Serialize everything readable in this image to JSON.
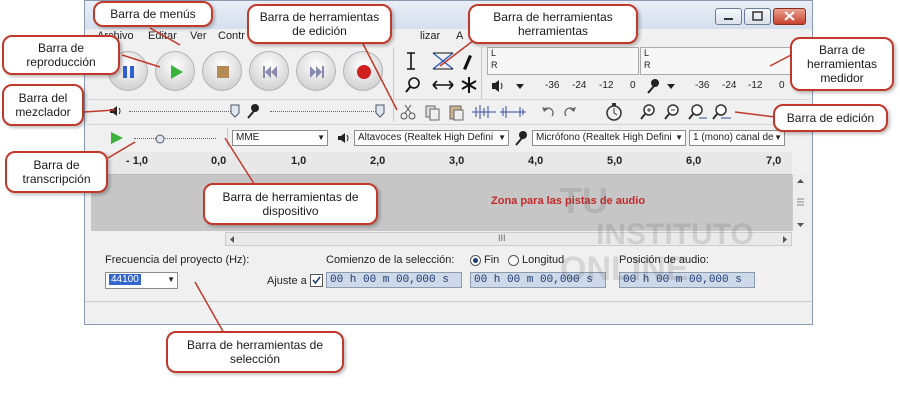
{
  "window": {
    "menus": [
      "Archivo",
      "Editar",
      "Ver",
      "Contr",
      "lizar",
      "A"
    ]
  },
  "meter": {
    "left_label": "L",
    "right_label": "R",
    "ticks": [
      "-36",
      "-24",
      "-12",
      "0"
    ]
  },
  "devices": {
    "host": "MME",
    "output": "Altavoces (Realtek High Defini",
    "input": "Micrófono (Realtek High Defini",
    "channels": "1 (mono) canal de"
  },
  "ruler": {
    "ticks": [
      "- 1,0",
      "0,0",
      "1,0",
      "2,0",
      "3,0",
      "4,0",
      "5,0",
      "6,0",
      "7,0"
    ]
  },
  "tracks_area": {
    "label": "Zona para las pistas de audio"
  },
  "scrollbar": {
    "grip": "III"
  },
  "selection": {
    "rate_label": "Frecuencia del proyecto (Hz):",
    "rate_value": "44100",
    "snap_label": "Ajuste a",
    "start_label": "Comienzo de la selección:",
    "end_option": "Fin",
    "length_option": "Longitud",
    "position_label": "Posición de audio:",
    "time_value": "00 h 00 m 00,000 s"
  },
  "callouts": {
    "menus": "Barra de menús",
    "playback": "Barra de reproducción",
    "mixer": "Barra del mezclador",
    "transcription": "Barra de transcripción",
    "edit_tools": "Barra de herramientas de edición",
    "tools": "Barra de herramientas herramientas",
    "meter": "Barra de herramientas medidor",
    "edit": "Barra de edición",
    "device": "Barra de herramientas de dispositivo",
    "selection": "Barra de herramientas de selección"
  },
  "watermark": [
    "TU",
    "INSTITUTO",
    "ONLINE"
  ],
  "colors": {
    "callout_border": "#c0392b",
    "tracks_label": "#c62828",
    "play_green": "#3bb33b",
    "pause_blue": "#2f5fd0",
    "record_red": "#d02020"
  }
}
